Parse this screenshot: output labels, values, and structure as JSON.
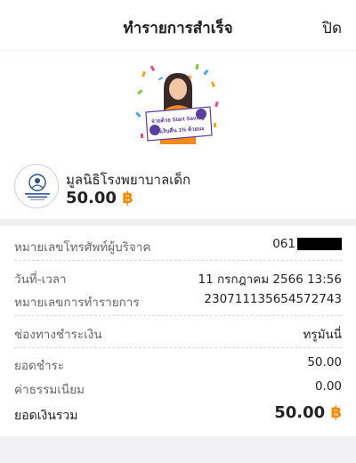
{
  "header": {
    "title": "ทำรายการสำเร็จ",
    "close_label": "ปิด"
  },
  "promo": {
    "banner_line1": "จ่ายด้วย Start Saving",
    "banner_line2": "ได้เงินคืน 1% ด้วยนะ"
  },
  "merchant": {
    "name": "มูลนิธิโรงพยาบาลเด็ก",
    "amount": "50.00",
    "currency_symbol": "฿"
  },
  "details": {
    "phone_label": "หมายเลขโทรศัพท์ผู้บริจาค",
    "phone_value": "061",
    "datetime_label": "วันที่-เวลา",
    "datetime_value": "11 กรกฎาคม 2566 13:56",
    "txn_label": "หมายเลขการทำรายการ",
    "txn_value": "230711135654572743",
    "channel_label": "ช่องทางชำระเงิน",
    "channel_value": "ทรูมันนี่"
  },
  "summary": {
    "payment_label": "ยอดชำระ",
    "payment_value": "50.00",
    "fee_label": "ค่าธรรมเนียม",
    "fee_value": "0.00",
    "total_label": "ยอดเงินรวม",
    "total_value": "50.00",
    "currency_symbol": "฿"
  },
  "colors": {
    "accent_orange": "#f08a00",
    "purple": "#5a3f9c"
  }
}
